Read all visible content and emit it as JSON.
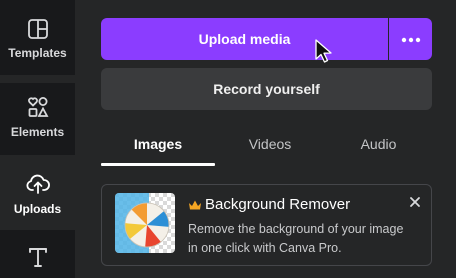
{
  "sidebar": {
    "items": [
      {
        "label": "Templates",
        "icon": "templates-icon",
        "active": false
      },
      {
        "label": "Elements",
        "icon": "elements-icon",
        "active": false
      },
      {
        "label": "Uploads",
        "icon": "upload-cloud-icon",
        "active": true
      },
      {
        "label": "Text",
        "icon": "text-icon",
        "active": false
      }
    ]
  },
  "actions": {
    "upload_label": "Upload media",
    "more_icon": "more-horizontal-icon",
    "record_label": "Record yourself"
  },
  "tabs": [
    {
      "label": "Images",
      "active": true
    },
    {
      "label": "Videos",
      "active": false
    },
    {
      "label": "Audio",
      "active": false
    }
  ],
  "promo": {
    "title": "Background Remover",
    "badge_icon": "crown-icon",
    "description": "Remove the background of your image in one click with Canva Pro.",
    "image": "beach-ball-thumbnail",
    "close_icon": "close-icon"
  },
  "colors": {
    "accent": "#8b3dff",
    "rail_bg": "#18191b",
    "panel_bg": "#252627",
    "secondary_button": "#3a3b3d",
    "crown": "#f5a623"
  }
}
